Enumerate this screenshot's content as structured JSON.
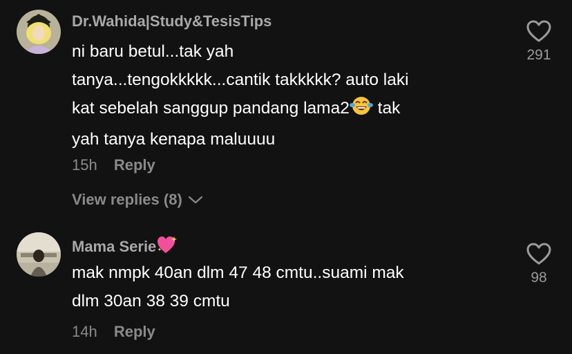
{
  "comments": [
    {
      "username": "Dr.Wahida|Study&TesisTips",
      "text_lines": [
        "ni baru betul...tak yah",
        "tanya...tengokkkkk...cantik takkkkk? auto laki",
        "kat sebelah sanggup pandang lama2",
        " tak",
        "yah tanya kenapa maluuuu"
      ],
      "inline_emoji": "face-with-tears-of-joy",
      "time": "15h",
      "reply_label": "Reply",
      "view_replies_label": "View replies (8)",
      "likes": "291"
    },
    {
      "username": "Mama Serie",
      "username_emoji": "sparkling-heart",
      "text_lines": [
        "mak nmpk 40an dlm 47 48 cmtu..suami mak",
        "dlm 30an 38 39 cmtu"
      ],
      "time": "14h",
      "reply_label": "Reply",
      "likes": "98"
    }
  ],
  "colors": {
    "background": "#121212",
    "username": "#a8a8a8",
    "body_text": "#ffffff",
    "meta": "#8a8a8a"
  }
}
